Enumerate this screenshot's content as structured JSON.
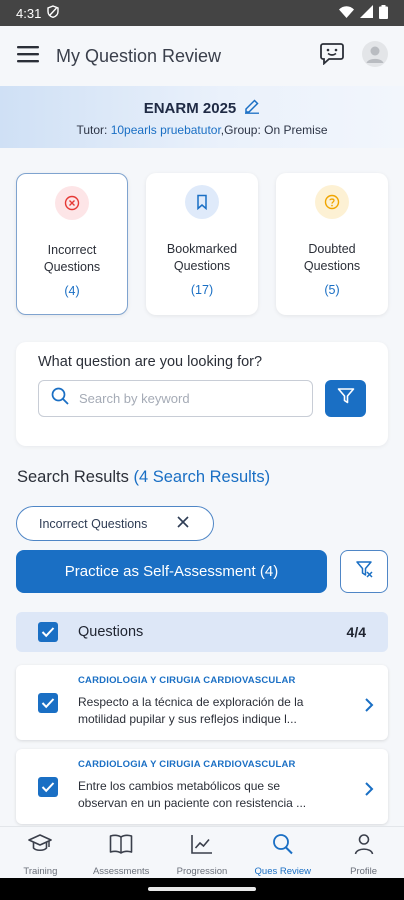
{
  "status_bar": {
    "time": "4:31"
  },
  "app_bar": {
    "title": "My Question Review"
  },
  "exam": {
    "title": "ENARM 2025",
    "tutor_prefix": "Tutor: ",
    "tutor_name": "10pearls pruebatutor",
    "group_text": ",Group: On Premise"
  },
  "categories": [
    {
      "label": "Incorrect Questions",
      "count": "(4)",
      "icon": "x-circle-icon",
      "color": "#e53935"
    },
    {
      "label": "Bookmarked Questions",
      "count": "(17)",
      "icon": "bookmark-icon",
      "color": "#1a6fc4"
    },
    {
      "label": "Doubted Questions",
      "count": "(5)",
      "icon": "question-circle-icon",
      "color": "#f0a500"
    }
  ],
  "search": {
    "question": "What question are you looking for?",
    "placeholder": "Search by keyword"
  },
  "results": {
    "heading": "Search Results",
    "count_text": "(4 Search Results)"
  },
  "chip": {
    "label": "Incorrect Questions"
  },
  "practice_button": {
    "label": "Practice as Self-Assessment (4)"
  },
  "questions_header": {
    "label": "Questions",
    "count": "4/4"
  },
  "questions": [
    {
      "category": "CARDIOLOGIA Y CIRUGIA CARDIOVASCULAR",
      "text": "Respecto a la técnica de exploración de la motilidad pupilar y sus reflejos indique l..."
    },
    {
      "category": "CARDIOLOGIA Y CIRUGIA CARDIOVASCULAR",
      "text": "Entre los cambios metabólicos que se observan en un paciente con resistencia ..."
    }
  ],
  "bottom_nav": [
    {
      "label": "Training",
      "icon": "graduation-cap-icon"
    },
    {
      "label": "Assessments",
      "icon": "book-icon"
    },
    {
      "label": "Progression",
      "icon": "chart-icon"
    },
    {
      "label": "Ques Review",
      "icon": "search-icon",
      "active": true
    },
    {
      "label": "Profile",
      "icon": "person-icon"
    }
  ],
  "colors": {
    "accent": "#1a6fc4",
    "incorrect": "#e53935",
    "doubted": "#f0a500"
  }
}
